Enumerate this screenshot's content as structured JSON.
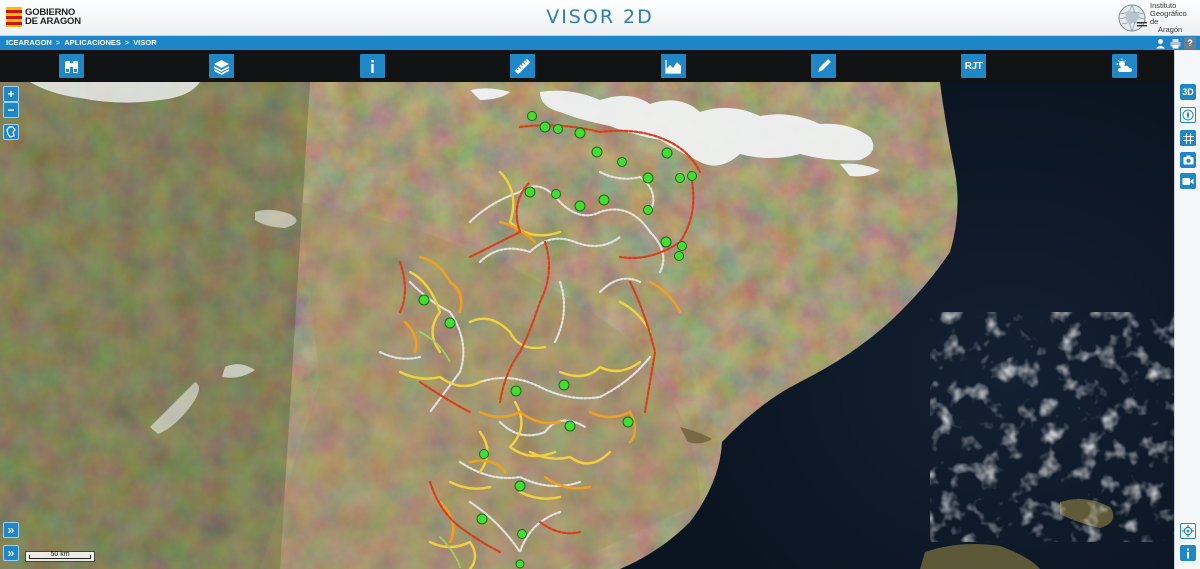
{
  "header": {
    "gov_logo_line1": "GOBIERNO",
    "gov_logo_line2": "DE ARAGON",
    "title": "VISOR 2D",
    "iga_line1": "Instituto",
    "iga_line2": "Geográfico de",
    "iga_line3": "Aragón"
  },
  "breadcrumb": {
    "items": [
      "ICEARAGON",
      "APLICACIONES",
      "VISOR"
    ],
    "separator": ">"
  },
  "top_right": {
    "help_label": "?",
    "icons": [
      "user-icon",
      "print-icon",
      "help-icon"
    ]
  },
  "toolbar": {
    "tools": [
      {
        "name": "binoculars-icon"
      },
      {
        "name": "layers-icon"
      },
      {
        "name": "info-icon"
      },
      {
        "name": "ruler-icon"
      },
      {
        "name": "profile-icon"
      },
      {
        "name": "pencil-icon"
      },
      {
        "name": "rjt-tool",
        "label": "RJT"
      },
      {
        "name": "weather-icon"
      }
    ]
  },
  "right_panel": {
    "view3d_label": "3D",
    "icons": [
      "view-3d-button",
      "compass-icon",
      "grid-icon",
      "camera-icon",
      "video-icon",
      "locate-icon",
      "info-icon"
    ]
  },
  "map_controls": {
    "zoom_in": "+",
    "zoom_out": "−",
    "expand_1": "»",
    "expand_2": "»"
  },
  "scale": {
    "label": "50 km"
  },
  "colors": {
    "accent": "#1f87c6",
    "title_blue": "#2a7fb8",
    "route_red": "#d8401c",
    "route_orange": "#f0a020",
    "route_yellow": "#f2d23c",
    "route_white": "#dcdcdc",
    "poi_green": "#44dd33"
  }
}
